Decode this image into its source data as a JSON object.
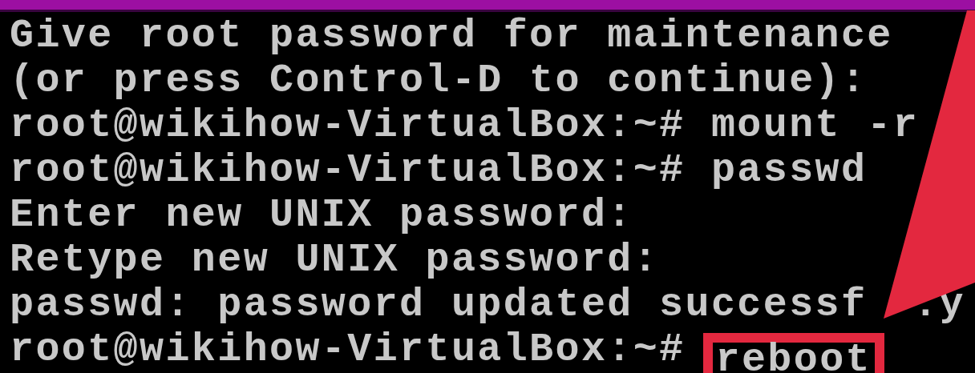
{
  "console": {
    "lines": [
      {
        "kind": "plain",
        "text": "Give root password for maintenance"
      },
      {
        "kind": "plain",
        "text": "(or press Control-D to continue):"
      },
      {
        "kind": "plain",
        "text": "root@wikihow-VirtualBox:~# mount -r"
      },
      {
        "kind": "plain",
        "text": "root@wikihow-VirtualBox:~# passwd"
      },
      {
        "kind": "plain",
        "text": "Enter new UNIX password:"
      },
      {
        "kind": "plain",
        "text": "Retype new UNIX password:"
      },
      {
        "kind": "split",
        "text": "passwd: password updated successf",
        "tail": ".y"
      },
      {
        "kind": "highlighted",
        "text": "root@wikihow-VirtualBox:~#",
        "highlight": "reboot"
      }
    ]
  }
}
